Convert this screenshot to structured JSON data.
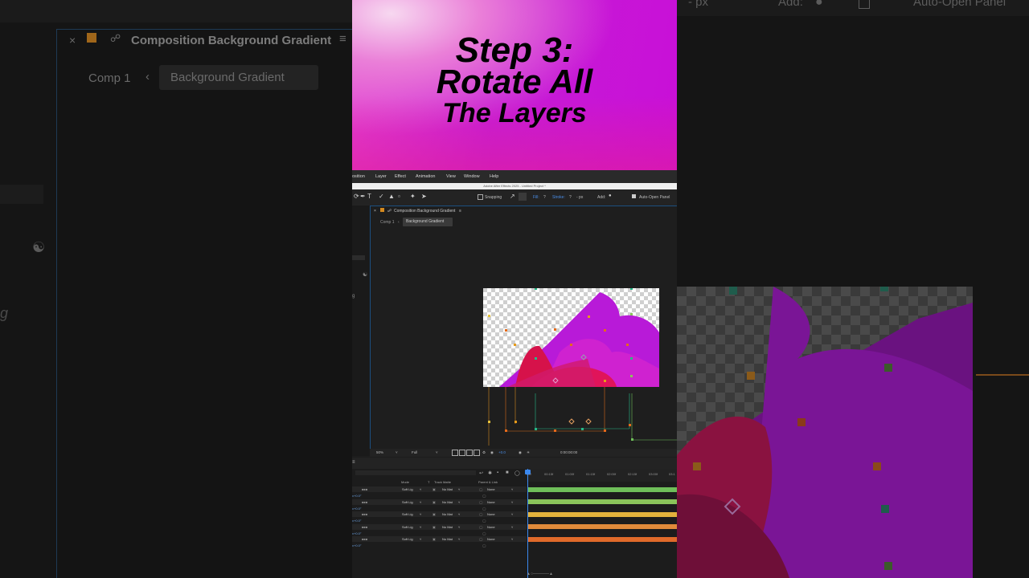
{
  "overlay": {
    "line1": "Step 3:",
    "line2": "Rotate All",
    "line3": "The Layers"
  },
  "menu": [
    "osition",
    "Layer",
    "Effect",
    "Animation",
    "View",
    "Window",
    "Help"
  ],
  "window_title": "Adobe After Effects 2025 - Untitled Project *",
  "toolbar": {
    "snapping": "Snapping",
    "fill": "Fill:",
    "fill_value": "?",
    "stroke": "Stroke:",
    "stroke_value": "?",
    "stroke_px": "- px",
    "add": "Add:",
    "auto_open": "Auto-Open Panel"
  },
  "composition": {
    "panel_title": "Composition Background Gradient",
    "breadcrumb_root": "Comp 1",
    "breadcrumb_current": "Background Gradient"
  },
  "viewer": {
    "zoom": "50%",
    "resolution": "Full",
    "exposure": "+0.0",
    "timecode": "0:00:00:00"
  },
  "timeline": {
    "columns": {
      "mode": "Mode",
      "t": "T",
      "track_matte": "Track Matte",
      "parent": "Parent & Link"
    },
    "ruler": [
      "00f",
      "00:15f",
      "01:00f",
      "01:15f",
      "02:00f",
      "02:15f",
      "03:00f",
      "03:1"
    ],
    "layers": [
      {
        "mode": "Soft Lig",
        "matte": "No Mat",
        "parent": "None",
        "rotation": "x+0.0°",
        "bar_color": "#6fbf5a"
      },
      {
        "mode": "Soft Lig",
        "matte": "No Mat",
        "parent": "None",
        "rotation": "x+0.0°",
        "bar_color": "#8ac45a"
      },
      {
        "mode": "Soft Lig",
        "matte": "No Mat",
        "parent": "None",
        "rotation": "x+0.0°",
        "bar_color": "#e3b23c"
      },
      {
        "mode": "Soft Lig",
        "matte": "No Mat",
        "parent": "None",
        "rotation": "x+0.0°",
        "bar_color": "#e08a3a"
      },
      {
        "mode": "Soft Lig",
        "matte": "No Mat",
        "parent": "None",
        "rotation": "x+0.0°",
        "bar_color": "#e06a2a"
      }
    ]
  },
  "background_left": {
    "title": "Composition Background Gradient",
    "comp1": "Comp 1",
    "crumb": "Background Gradient"
  },
  "background_right": {
    "px": "- px",
    "add": "Add:",
    "auto_open": "Auto-Open Panel"
  },
  "colors": {
    "accent_blue": "#3b88ee",
    "banner_magenta": "#c90fd7",
    "layer_purple": "#b81ad8",
    "layer_red": "#e0145a"
  }
}
